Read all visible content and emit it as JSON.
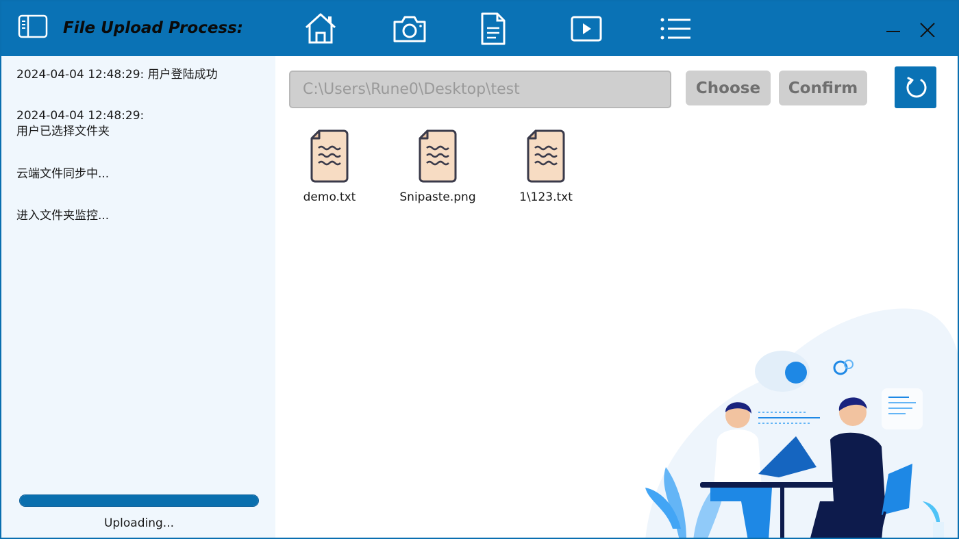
{
  "app": {
    "title": "File Upload Process:"
  },
  "titlebar": {
    "nav": [
      {
        "icon": "home-icon"
      },
      {
        "icon": "camera-icon"
      },
      {
        "icon": "document-icon"
      },
      {
        "icon": "play-icon"
      },
      {
        "icon": "list-icon"
      }
    ],
    "minimize_icon": "minimize-icon",
    "close_icon": "close-icon"
  },
  "log": [
    "2024-04-04 12:48:29: 用户登陆成功",
    "2024-04-04 12:48:29:\n用户已选择文件夹",
    "云端文件同步中...",
    "进入文件夹监控..."
  ],
  "progress": {
    "value": 1.0,
    "label": "Uploading..."
  },
  "toolbar": {
    "path_value": "C:\\Users\\Rune0\\Desktop\\test",
    "choose_label": "Choose",
    "confirm_label": "Confirm",
    "refresh_icon": "refresh-icon"
  },
  "files": [
    {
      "name": "demo.txt",
      "icon": "text-file-icon"
    },
    {
      "name": "Snipaste.png",
      "icon": "text-file-icon"
    },
    {
      "name": "1\\123.txt",
      "icon": "text-file-icon"
    }
  ],
  "colors": {
    "accent": "#0a72b5",
    "sidebar_bg": "#f0f7fd",
    "button_gray": "#cfcfcf",
    "file_icon_fill": "#f7dcc3"
  }
}
